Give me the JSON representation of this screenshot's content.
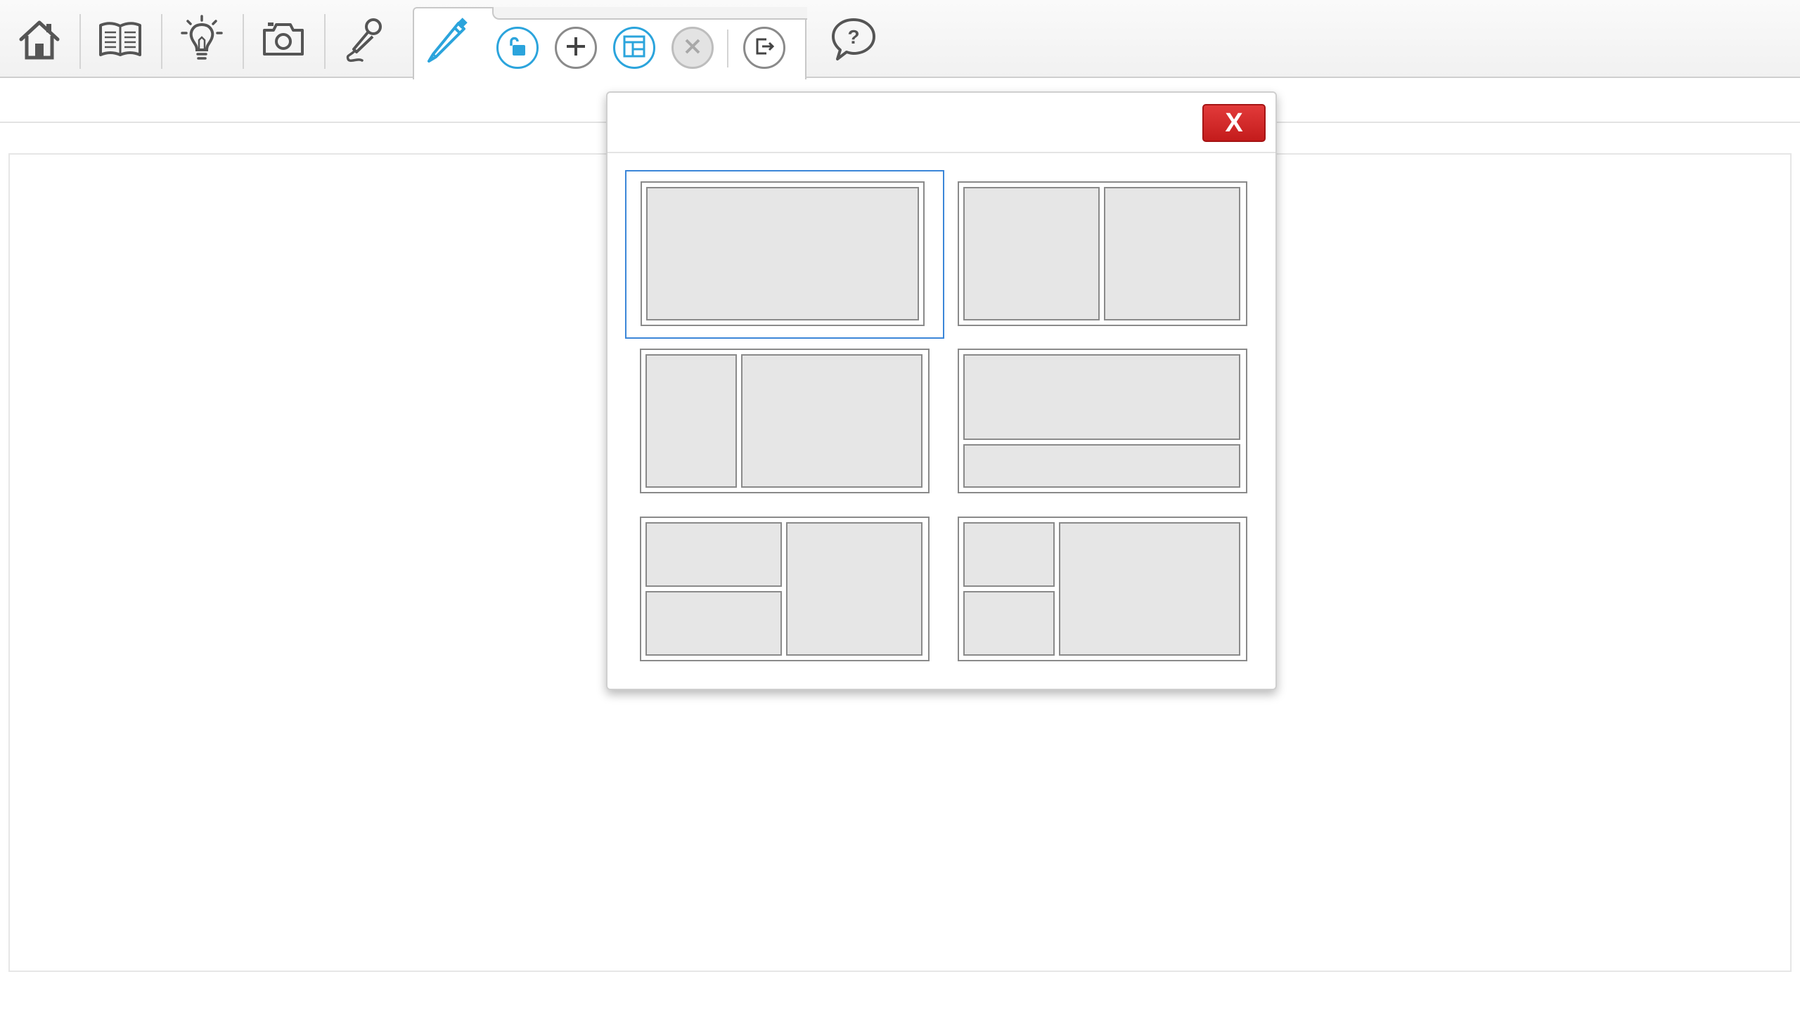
{
  "toolbar": {
    "buttons": [
      "home-icon",
      "book-icon",
      "lightbulb-icon",
      "camera-icon",
      "microphone-icon",
      "pencil-icon",
      "help-icon"
    ],
    "edit_actions": [
      "unlock-icon",
      "plus-icon",
      "layout-icon",
      "close-icon",
      "exit-icon"
    ]
  },
  "dialog": {
    "close_label": "X",
    "layouts": [
      {
        "id": "single",
        "selected": true
      },
      {
        "id": "two-columns-equal",
        "selected": false
      },
      {
        "id": "narrow-left-wide-right",
        "selected": false
      },
      {
        "id": "top-large-bottom-small",
        "selected": false
      },
      {
        "id": "two-stacked-left-one-right",
        "selected": false
      },
      {
        "id": "two-small-stacked-left-wide-right",
        "selected": false
      }
    ]
  },
  "colors": {
    "accent_blue": "#2ba4dc",
    "icon_gray": "#555555",
    "close_red": "#d32626",
    "selection_blue": "#3b86d8",
    "cell_fill": "#e6e6e6"
  }
}
